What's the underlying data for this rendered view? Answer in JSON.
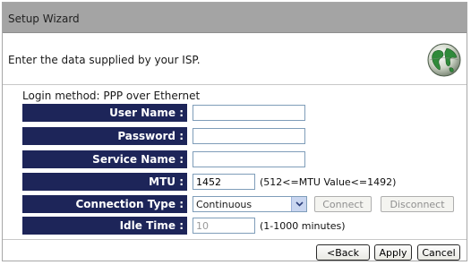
{
  "window": {
    "title": "Setup Wizard"
  },
  "intro": {
    "text": "Enter the data supplied by your ISP."
  },
  "login": {
    "method_text": "Login method: PPP over Ethernet"
  },
  "fields": {
    "user_name": {
      "label": "User Name :",
      "value": ""
    },
    "password": {
      "label": "Password :",
      "value": ""
    },
    "service_name": {
      "label": "Service Name :",
      "value": ""
    },
    "mtu": {
      "label": "MTU :",
      "value": "1452",
      "hint": "(512<=MTU Value<=1492)"
    },
    "connection_type": {
      "label": "Connection Type :",
      "value": "Continuous"
    },
    "idle_time": {
      "label": "Idle Time :",
      "value": "10",
      "hint": "(1-1000 minutes)"
    }
  },
  "actions": {
    "connect": "Connect",
    "disconnect": "Disconnect",
    "back": "<Back",
    "apply": "Apply",
    "cancel": "Cancel"
  },
  "icons": {
    "globe": "globe-icon",
    "dropdown": "chevron-down-icon"
  },
  "colors": {
    "label_bg": "#1d2559",
    "titlebar_bg": "#a4a4a4"
  }
}
